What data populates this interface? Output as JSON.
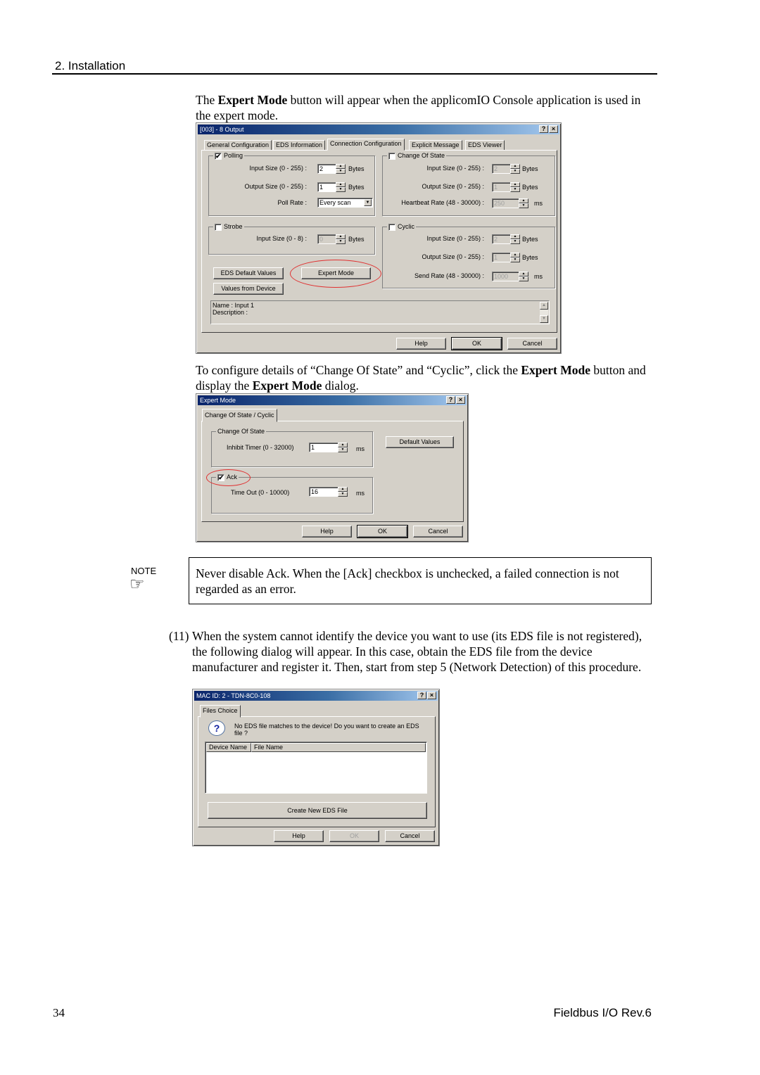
{
  "page": {
    "section_title": "2. Installation",
    "page_number": "34",
    "doc_title": "Fieldbus I/O Rev.6"
  },
  "text": {
    "p1_pre": "The ",
    "p1_bold": "Expert Mode",
    "p1_post": " button will appear when the applicomIO Console application is used in the expert mode.",
    "p2_pre": "To configure details of “Change Of State” and “Cyclic”, click the ",
    "p2_bold1": "Expert Mode",
    "p2_mid": " button and display the ",
    "p2_bold2": "Expert Mode",
    "p2_post": " dialog.",
    "note_label": "NOTE",
    "note_icon": "pointing-hand-icon",
    "note_text": "Never disable Ack.  When the [Ack] checkbox is unchecked, a failed connection is not regarded as an error.",
    "step11_num": "(11)",
    "step11_text": "When the system cannot identify the device you want to use (its EDS file is not registered), the following dialog will appear.  In this case, obtain the EDS file from the device manufacturer and register it.  Then, start from step 5 (Network Detection) of this procedure."
  },
  "dialog1": {
    "title": "[003]  -  8 Output",
    "help_btn": "?",
    "close_btn": "×",
    "tabs": [
      "General Configuration",
      "EDS Information",
      "Connection Configuration",
      "Explicit Message",
      "EDS Viewer"
    ],
    "active_tab": "Connection Configuration",
    "polling": {
      "label": "Polling",
      "checked": "✔",
      "input_label": "Input Size (0 - 255) :",
      "input_value": "2",
      "input_unit": "Bytes",
      "output_label": "Output Size (0 - 255) :",
      "output_value": "1",
      "output_unit": "Bytes",
      "rate_label": "Poll Rate :",
      "rate_value": "Every scan",
      "rate_arrow": "▼"
    },
    "cos": {
      "label": "Change Of State",
      "checked": "",
      "input_label": "Input Size (0 - 255) :",
      "input_value": "2",
      "input_unit": "Bytes",
      "output_label": "Output Size (0 - 255) :",
      "output_value": "1",
      "output_unit": "Bytes",
      "hb_label": "Heartbeat Rate (48 - 30000) :",
      "hb_value": "250",
      "hb_unit": "ms"
    },
    "strobe": {
      "label": "Strobe",
      "checked": "",
      "input_label": "Input Size (0 - 8) :",
      "input_value": "0",
      "input_unit": "Bytes"
    },
    "cyclic": {
      "label": "Cyclic",
      "checked": "",
      "input_label": "Input Size (0 - 255) :",
      "input_value": "2",
      "input_unit": "Bytes",
      "output_label": "Output Size (0 - 255) :",
      "output_value": "1",
      "output_unit": "Bytes",
      "send_label": "Send Rate (48 - 30000) :",
      "send_value": "1000",
      "send_unit": "ms"
    },
    "eds_default_btn": "EDS Default Values",
    "expert_mode_btn": "Expert Mode",
    "values_device_btn": "Values from Device",
    "info_name": "Name : Input 1",
    "info_desc": "Description :",
    "help": "Help",
    "ok": "OK",
    "cancel": "Cancel"
  },
  "dialog2": {
    "title": "Expert Mode",
    "help_btn": "?",
    "close_btn": "×",
    "tab": "Change Of State / Cyclic",
    "cos_group": "Change Of State",
    "inhibit_label": "Inhibit Timer (0 - 32000)",
    "inhibit_value": "1",
    "inhibit_unit": "ms",
    "default_values_btn": "Default Values",
    "ack_label": "Ack",
    "ack_checked": "✔",
    "timeout_label": "Time Out (0 - 10000)",
    "timeout_value": "16",
    "timeout_unit": "ms",
    "help": "Help",
    "ok": "OK",
    "cancel": "Cancel"
  },
  "dialog3": {
    "title": "MAC ID: 2 - TDN-8C0-108",
    "help_btn": "?",
    "close_btn": "×",
    "tab": "Files Choice",
    "question_icon": "?",
    "message": "No EDS file matches to the device! Do you want to create an EDS file ?",
    "columns": [
      "Device Name",
      "File Name"
    ],
    "rows": [],
    "create_btn": "Create New EDS File",
    "help": "Help",
    "ok": "OK",
    "cancel": "Cancel"
  }
}
